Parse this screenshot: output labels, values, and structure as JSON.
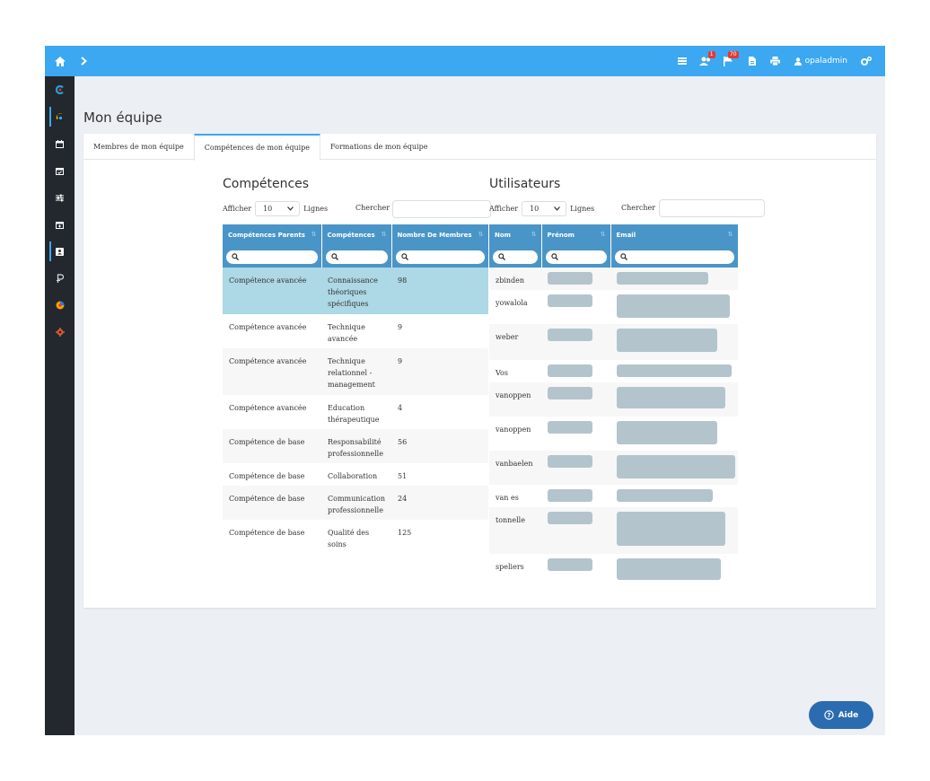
{
  "topbar": {
    "user_name": "opaladmin",
    "badges": {
      "users": "1",
      "flag": "70"
    },
    "color": "#3ba8f1"
  },
  "sidebar": {
    "items": [
      {
        "icon": "c-logo-icon"
      },
      {
        "icon": "moon-logo-icon"
      },
      {
        "icon": "calendar-icon"
      },
      {
        "icon": "calendar-check-icon"
      },
      {
        "icon": "sliders-icon"
      },
      {
        "icon": "calendar-plus-icon"
      },
      {
        "icon": "contact-card-icon"
      },
      {
        "icon": "p-logo-icon"
      },
      {
        "icon": "circle-logo-icon"
      },
      {
        "icon": "gear-icon"
      }
    ]
  },
  "page": {
    "title": "Mon équipe"
  },
  "tabs": [
    {
      "label": "Membres de mon équipe"
    },
    {
      "label": "Compétences de mon équipe"
    },
    {
      "label": "Formations de mon équipe"
    }
  ],
  "competences": {
    "title": "Compétences",
    "show_label": "Afficher",
    "rows_value": "10",
    "rows_label": "Lignes",
    "search_label": "Chercher",
    "columns": [
      "Compétences Parents",
      "Compétences",
      "Nombre De Membres"
    ],
    "rows": [
      {
        "parent": "Compétence avancée",
        "name": "Connaissance théoriques spécifiques",
        "count": "98"
      },
      {
        "parent": "Compétence avancée",
        "name": "Technique avancée",
        "count": "9"
      },
      {
        "parent": "Compétence avancée",
        "name": "Technique relationnel - management",
        "count": "9"
      },
      {
        "parent": "Compétence avancée",
        "name": "Education thérapeutique",
        "count": "4"
      },
      {
        "parent": "Compétence de base",
        "name": "Responsabilité professionnelle",
        "count": "56"
      },
      {
        "parent": "Compétence de base",
        "name": "Collaboration",
        "count": "51"
      },
      {
        "parent": "Compétence de base",
        "name": "Communication professionnelle",
        "count": "24"
      },
      {
        "parent": "Compétence de base",
        "name": "Qualité des soins",
        "count": "125"
      }
    ]
  },
  "utilisateurs": {
    "title": "Utilisateurs",
    "show_label": "Afficher",
    "rows_value": "10",
    "rows_label": "Lignes",
    "search_label": "Chercher",
    "columns": [
      "Nom",
      "Prénom",
      "Email"
    ],
    "rows": [
      {
        "nom": "zbinden"
      },
      {
        "nom": "yowalola"
      },
      {
        "nom": "weber"
      },
      {
        "nom": "Vos"
      },
      {
        "nom": "vanoppen"
      },
      {
        "nom": "vanoppen"
      },
      {
        "nom": "vanbaelen"
      },
      {
        "nom": "van es"
      },
      {
        "nom": "tonnelle"
      },
      {
        "nom": "speliers"
      }
    ]
  },
  "help": {
    "label": "Aide"
  }
}
